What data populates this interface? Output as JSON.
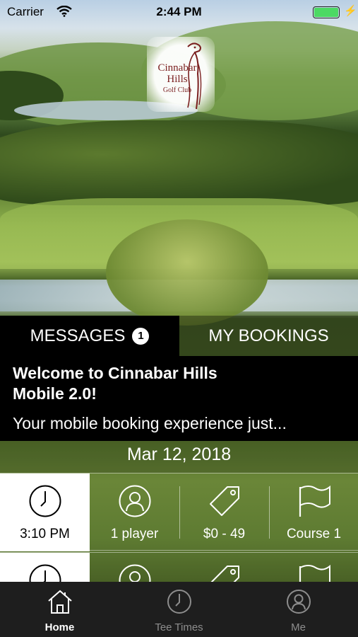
{
  "status_bar": {
    "carrier": "Carrier",
    "time": "2:44 PM",
    "battery_color": "#4cd964"
  },
  "logo": {
    "name_line1": "Cinnabar Hills",
    "name_line2": "Golf Club",
    "icon": "eagle-logo"
  },
  "tabs": {
    "messages_label": "MESSAGES",
    "messages_count": "1",
    "bookings_label": "MY BOOKINGS"
  },
  "message": {
    "title_line1": "Welcome to Cinnabar Hills",
    "title_line2": "Mobile 2.0!",
    "body": "Your mobile booking experience just..."
  },
  "date": "Mar 12, 2018",
  "tee_times": [
    {
      "time": "3:10 PM",
      "players": "1 player",
      "price": "$0 - 49",
      "course": "Course 1"
    },
    {
      "time": "",
      "players": "",
      "price": "",
      "course": ""
    }
  ],
  "bottom_nav": {
    "items": [
      {
        "label": "Home",
        "icon": "house-icon",
        "active": true
      },
      {
        "label": "Tee Times",
        "icon": "clock-icon",
        "active": false
      },
      {
        "label": "Me",
        "icon": "person-icon",
        "active": false
      }
    ]
  },
  "colors": {
    "accent": "#ffffff",
    "panel": "#000000",
    "tabbar": "#1e1e1e",
    "inactive": "#8d8d8d"
  }
}
